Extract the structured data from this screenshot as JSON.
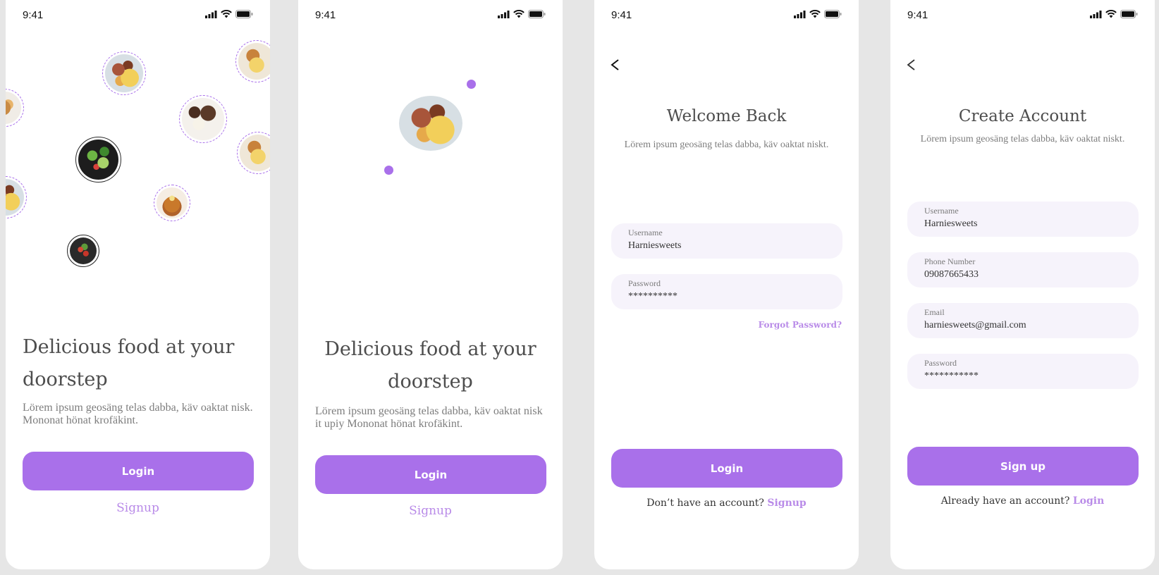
{
  "status": {
    "time": "9:41"
  },
  "screen1": {
    "headline": "Delicious food at your doorstep",
    "subtext": "Lörem ipsum geosäng telas dabba, käv oaktat nisk. Mononat hönat krofäkint.",
    "login_label": "Login",
    "signup_label": "Signup"
  },
  "screen2": {
    "headline": "Delicious food at your doorstep",
    "subtext": "Lörem ipsum geosäng telas dabba, käv oaktat nisk it upiy Mononat hönat krofäkint.",
    "login_label": "Login",
    "signup_label": "Signup"
  },
  "screen3": {
    "title": "Welcome Back",
    "subtitle": "Lörem ipsum geosäng telas dabba, käv oaktat niskt.",
    "username_label": "Username",
    "username_value": "Harniesweets",
    "password_label": "Password",
    "password_value": "**********",
    "forgot_label": "Forgot Password?",
    "login_label": "Login",
    "no_account_text": "Don’t have an account?",
    "signup_link": "Signup"
  },
  "screen4": {
    "title": "Create Account",
    "subtitle": "Lörem ipsum geosäng telas dabba, käv oaktat niskt.",
    "username_label": "Username",
    "username_value": "Harniesweets",
    "phone_label": "Phone Number",
    "phone_value": "09087665433",
    "email_label": "Email",
    "email_value": "harniesweets@gmail.com",
    "password_label": "Password",
    "password_value": "***********",
    "signup_label": "Sign up",
    "have_account_text": "Already have an account?",
    "login_link": "Login"
  },
  "colors": {
    "accent": "#a970ea",
    "accent_light": "#b98be8",
    "field_bg": "#f6f3fb",
    "canvas": "#e6e6e6"
  },
  "icons": [
    "signal-icon",
    "wifi-icon",
    "battery-icon",
    "back-arrow-icon"
  ]
}
